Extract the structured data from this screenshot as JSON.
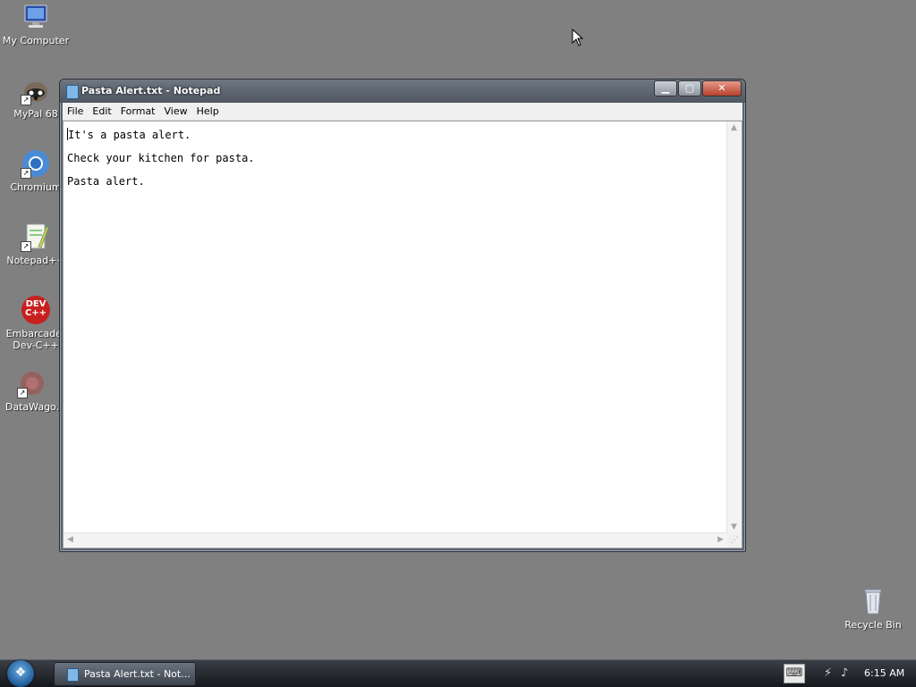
{
  "desktop": {
    "icons": [
      {
        "label": "My Computer",
        "icon": "computer-icon"
      },
      {
        "label": "MyPal 68",
        "icon": "mypal-raccoon-icon"
      },
      {
        "label": "Chromium",
        "icon": "chromium-icon"
      },
      {
        "label": "Notepad++",
        "icon": "notepadpp-icon"
      },
      {
        "label": "Embarcader Dev-C++",
        "icon": "devcpp-icon",
        "badge": "DEV C++"
      },
      {
        "label": "DataWago.",
        "icon": "datawago-icon"
      },
      {
        "label": "Recycle Bin",
        "icon": "recycle-bin-icon"
      }
    ]
  },
  "window": {
    "title": "Pasta Alert.txt - Notepad",
    "menu": [
      "File",
      "Edit",
      "Format",
      "View",
      "Help"
    ],
    "lines": [
      "It's a pasta alert.",
      "Check your kitchen for pasta.",
      "Pasta alert."
    ]
  },
  "taskbar": {
    "task_label": "Pasta Alert.txt - Not...",
    "clock": "6:15 AM"
  },
  "colors": {
    "desktop_bg": "#808080",
    "taskbar": "#1c2026"
  }
}
